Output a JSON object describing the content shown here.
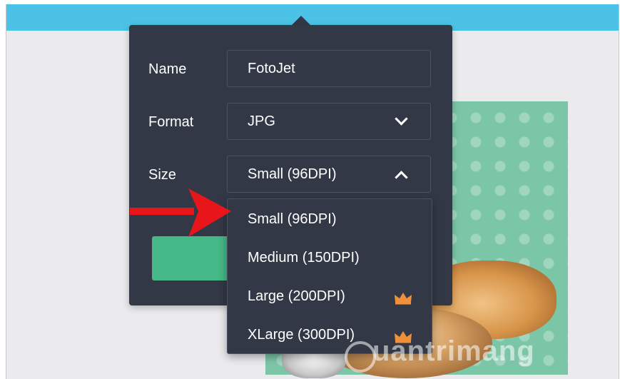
{
  "form": {
    "name_label": "Name",
    "name_value": "FotoJet",
    "format_label": "Format",
    "format_value": "JPG",
    "size_label": "Size",
    "size_value": "Small (96DPI)"
  },
  "size_options": [
    {
      "label": "Small (96DPI)",
      "premium": false
    },
    {
      "label": "Medium (150DPI)",
      "premium": false
    },
    {
      "label": "Large (200DPI)",
      "premium": true
    },
    {
      "label": "XLarge (300DPI)",
      "premium": true
    }
  ],
  "icons": {
    "format_chevron": "chevron-down-icon",
    "size_chevron": "chevron-up-icon",
    "premium": "crown-icon"
  },
  "colors": {
    "topbar": "#4cc3e6",
    "panel": "#333846",
    "download_button": "#45b987",
    "crown": "#f0913a",
    "annotation_arrow": "#e8161b"
  },
  "watermark": "uantrimang"
}
